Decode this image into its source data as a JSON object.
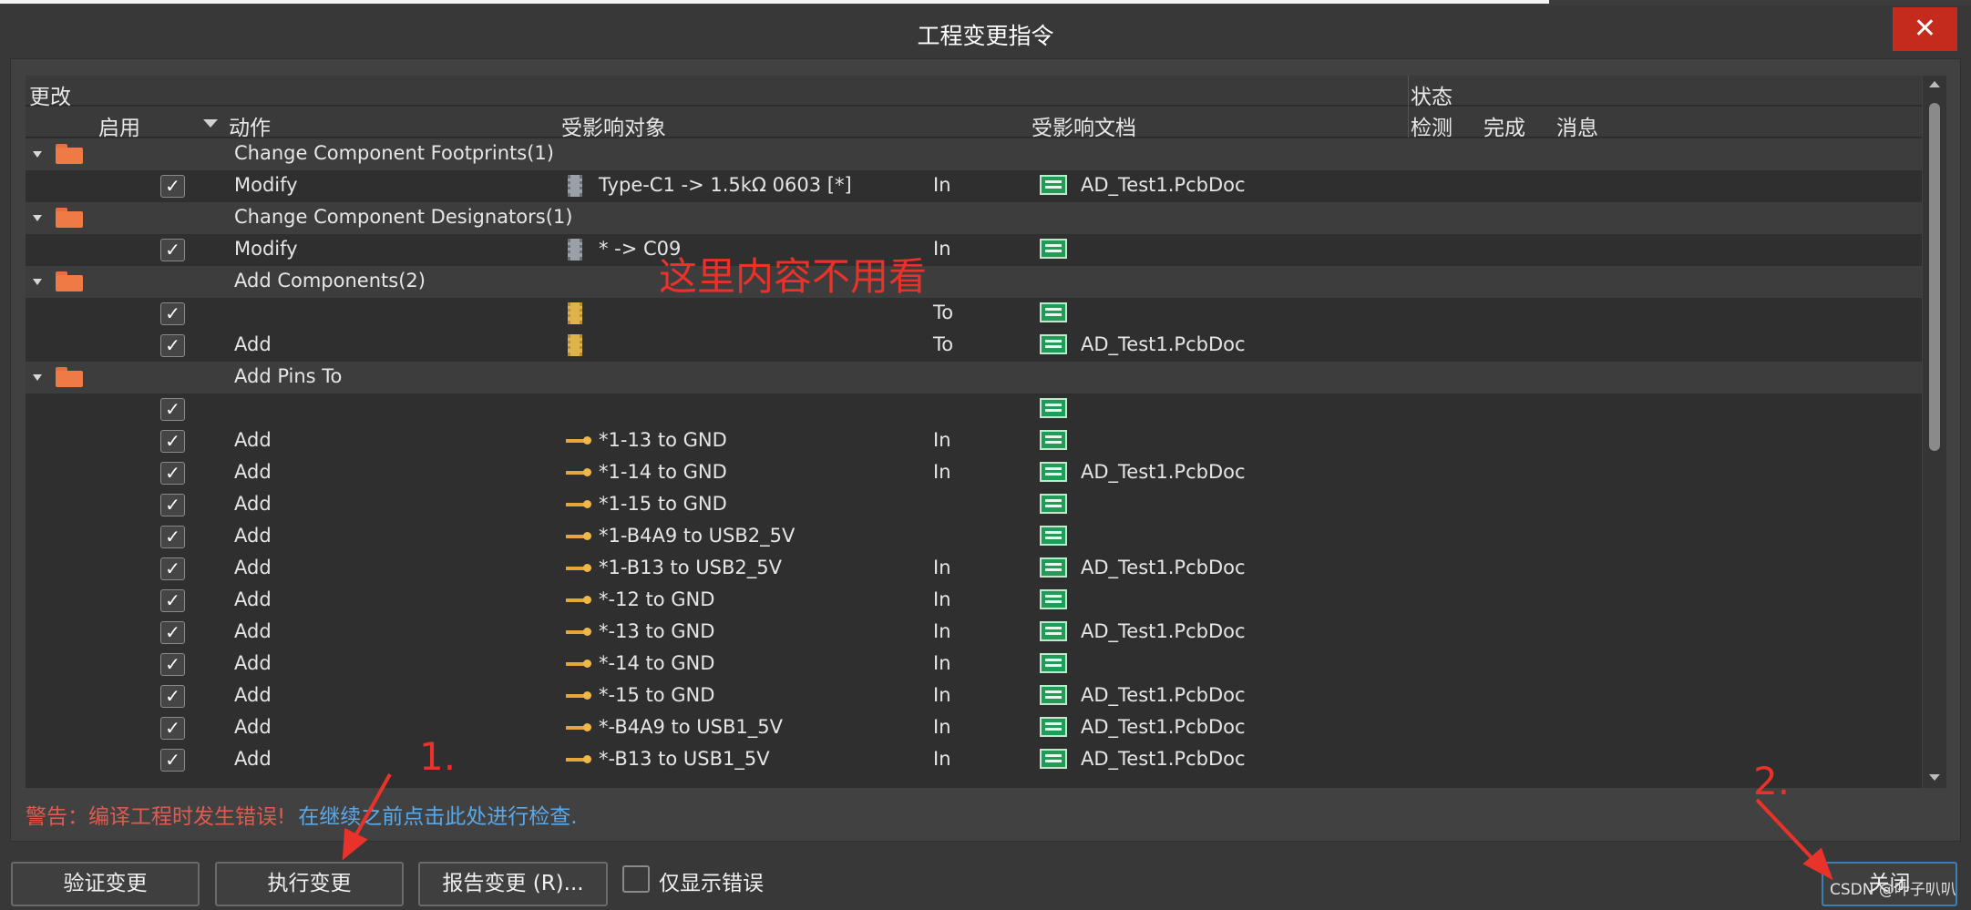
{
  "dialog": {
    "title": "工程变更指令",
    "close_icon_glyph": "✕"
  },
  "header": {
    "group_changes": "更改",
    "group_status": "状态",
    "col_enable": "启用",
    "col_action": "动作",
    "col_affected_object": "受影响对象",
    "col_affected_doc": "受影响文档",
    "col_check": "检测",
    "col_done": "完成",
    "col_message": "消息"
  },
  "rows": [
    {
      "kind": "group",
      "label": "Change Component Footprints(1)"
    },
    {
      "kind": "item",
      "action": "Modify",
      "icon": "component-icon",
      "object": "Type-C1 -> 1.5kΩ  0603 [*]",
      "dir": "In",
      "doc": "AD_Test1.PcbDoc"
    },
    {
      "kind": "group",
      "label": "Change Component Designators(1)"
    },
    {
      "kind": "item",
      "action": "Modify",
      "icon": "component-icon",
      "object": "* -> C09",
      "dir": "In",
      "doc": ""
    },
    {
      "kind": "group",
      "label": "Add Components(2)"
    },
    {
      "kind": "item",
      "action": "",
      "icon": "footprint-icon",
      "object": "",
      "dir": "To",
      "doc": ""
    },
    {
      "kind": "item",
      "action": "Add",
      "icon": "footprint-icon",
      "object": "",
      "dir": "To",
      "doc": "AD_Test1.PcbDoc"
    },
    {
      "kind": "group",
      "label": "Add Pins To"
    },
    {
      "kind": "item",
      "action": "",
      "icon": "",
      "object": "",
      "dir": "",
      "doc": ""
    },
    {
      "kind": "item",
      "action": "Add",
      "icon": "pin-icon",
      "object": "*1-13 to GND",
      "dir": "In",
      "doc": ""
    },
    {
      "kind": "item",
      "action": "Add",
      "icon": "pin-icon",
      "object": "*1-14 to GND",
      "dir": "In",
      "doc": "AD_Test1.PcbDoc"
    },
    {
      "kind": "item",
      "action": "Add",
      "icon": "pin-icon",
      "object": "*1-15 to GND",
      "dir": "",
      "doc": ""
    },
    {
      "kind": "item",
      "action": "Add",
      "icon": "pin-icon",
      "object": "*1-B4A9 to USB2_5V",
      "dir": "",
      "doc": ""
    },
    {
      "kind": "item",
      "action": "Add",
      "icon": "pin-icon",
      "object": "*1-B13 to USB2_5V",
      "dir": "In",
      "doc": "AD_Test1.PcbDoc"
    },
    {
      "kind": "item",
      "action": "Add",
      "icon": "pin-icon",
      "object": "*-12 to GND",
      "dir": "In",
      "doc": ""
    },
    {
      "kind": "item",
      "action": "Add",
      "icon": "pin-icon",
      "object": "*-13 to GND",
      "dir": "In",
      "doc": "AD_Test1.PcbDoc"
    },
    {
      "kind": "item",
      "action": "Add",
      "icon": "pin-icon",
      "object": "*-14 to GND",
      "dir": "In",
      "doc": ""
    },
    {
      "kind": "item",
      "action": "Add",
      "icon": "pin-icon",
      "object": "*-15 to GND",
      "dir": "In",
      "doc": "AD_Test1.PcbDoc"
    },
    {
      "kind": "item",
      "action": "Add",
      "icon": "pin-icon",
      "object": "*-B4A9 to USB1_5V",
      "dir": "In",
      "doc": "AD_Test1.PcbDoc"
    },
    {
      "kind": "item",
      "action": "Add",
      "icon": "pin-icon",
      "object": "*-B13 to USB1_5V",
      "dir": "In",
      "doc": "AD_Test1.PcbDoc"
    }
  ],
  "overlay_note": "这里内容不用看",
  "warning": {
    "text": "警告：编译工程时发生错误!",
    "link": "在继续之前点击此处进行检查."
  },
  "buttons": {
    "validate": "验证变更",
    "execute": "执行变更",
    "report": "报告变更 (R)...",
    "only_errors": "仅显示错误",
    "close": "关闭"
  },
  "annotations": {
    "step1": "1.",
    "step2": "2."
  },
  "watermark": "CSDN @叶子叭叭",
  "colors": {
    "background": "#383838",
    "grid": "#2f2f2f",
    "warning_red": "#e05a4f",
    "link_blue": "#5aa8e8",
    "annotation_red": "#e8322a",
    "close_button": "#c42b1c"
  }
}
